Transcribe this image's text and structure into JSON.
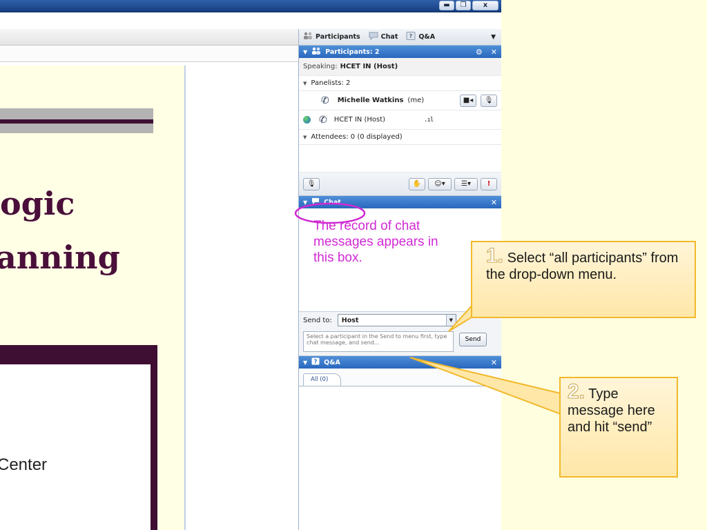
{
  "window": {
    "minimize_label": "▬",
    "restore_label": "❐",
    "close_label": "x"
  },
  "slide": {
    "title_line1": "ogic",
    "title_line2": "anning",
    "center_text": "Center"
  },
  "panel": {
    "tabs": [
      {
        "label": "Participants",
        "icon": "participants-icon"
      },
      {
        "label": "Chat",
        "icon": "chat-icon"
      },
      {
        "label": "Q&A",
        "icon": "qa-icon"
      }
    ],
    "participants_header": "Participants: 2",
    "speaking_label": "Speaking:",
    "speaking_name": "HCET IN (Host)",
    "panelists_label": "Panelists: 2",
    "panelist1_name": "Michelle Watkins",
    "panelist1_suffix": "(me)",
    "panelist2_name": "HCET IN (Host)",
    "attendees_label": "Attendees: 0 (0 displayed)",
    "raise_hand_icon": "hand-icon",
    "alert_label": "!",
    "chat_header": "Chat",
    "chat_note": "The record of chat messages appears in this box.",
    "send_to_label": "Send to:",
    "send_to_value": "Host",
    "compose_placeholder": "Select a participant in the Send to menu first, type chat message, and send...",
    "send_button": "Send",
    "qa_header": "Q&A",
    "qa_tab_all": "All (0)"
  },
  "callouts": {
    "step1_number": "1.",
    "step1_text": "Select “all participants” from the drop-down menu.",
    "step2_number": "2.",
    "step2_text": "Type message here and hit “send”"
  },
  "colors": {
    "accent_blue": "#2967bd",
    "chat_note_magenta": "#d02ad3",
    "callout_border": "#f2b82a",
    "slide_maroon": "#4a0f3a"
  }
}
